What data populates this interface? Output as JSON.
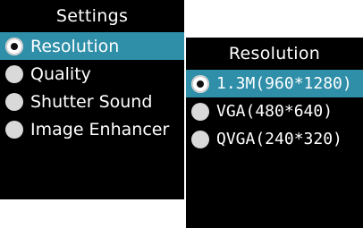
{
  "settings": {
    "title": "Settings",
    "items": [
      {
        "label": "Resolution",
        "selected": true
      },
      {
        "label": "Quality",
        "selected": false
      },
      {
        "label": "Shutter Sound",
        "selected": false
      },
      {
        "label": "Image Enhancer",
        "selected": false
      }
    ]
  },
  "resolution": {
    "title": "Resolution",
    "items": [
      {
        "label": "1.3M(960*1280)",
        "selected": true
      },
      {
        "label": "VGA(480*640)",
        "selected": false
      },
      {
        "label": "QVGA(240*320)",
        "selected": false
      }
    ]
  },
  "colors": {
    "highlight": "#2f8ea8",
    "panel_bg": "#000000",
    "text": "#ffffff",
    "radio": "#d9d9d9"
  }
}
